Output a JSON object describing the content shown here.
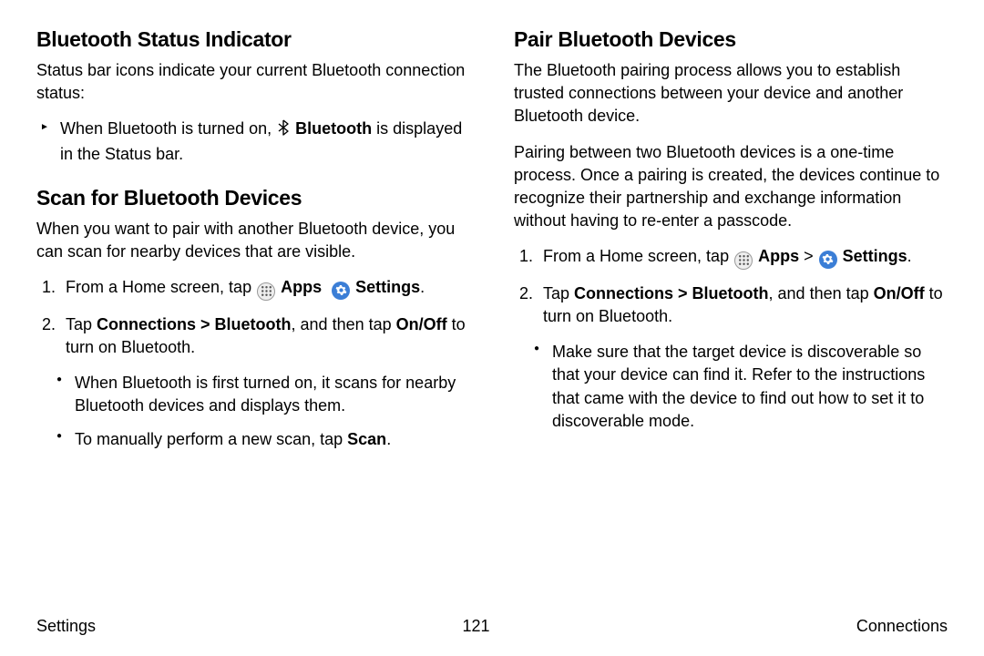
{
  "left": {
    "h1": "Bluetooth Status Indicator",
    "p1": "Status bar icons indicate your current Bluetooth connection status:",
    "b1a": "When Bluetooth is turned on, ",
    "b1_bt": "Bluetooth",
    "b1b": " is displayed in the Status bar.",
    "h2": "Scan for Bluetooth Devices",
    "p2": "When you want to pair with another Bluetooth device, you can scan for nearby devices that are visible.",
    "s1a": "From a Home screen, tap ",
    "s1_apps": "Apps",
    "s1_settings": "Settings",
    "s1_dot": ".",
    "s2a": "Tap ",
    "s2b": "Connections > Bluetooth",
    "s2c": ", and then tap ",
    "s2d": "On/Off",
    "s2e": " to turn on Bluetooth.",
    "s2_sub1": "When Bluetooth is first turned on, it scans for nearby Bluetooth devices and displays them.",
    "s2_sub2a": "To manually perform a new scan, tap ",
    "s2_sub2b": "Scan",
    "s2_sub2c": "."
  },
  "right": {
    "h1": "Pair Bluetooth Devices",
    "p1": "The Bluetooth pairing process allows you to establish trusted connections between your device and another Bluetooth device.",
    "p2": "Pairing between two Bluetooth devices is a one-time process. Once a pairing is created, the devices continue to recognize their partnership and exchange information without having to re-enter a passcode.",
    "s1a": "From a Home screen, tap ",
    "s1_apps": "Apps",
    "s1_gt": " > ",
    "s1_settings": "Settings",
    "s1_dot": ".",
    "s2a": "Tap ",
    "s2b": "Connections > Bluetooth",
    "s2c": ", and then tap ",
    "s2d": "On/Off",
    "s2e": " to turn on Bluetooth.",
    "s2_sub1": "Make sure that the target device is discoverable so that your device can find it. Refer to the instructions that came with the device to find out how to set it to discoverable mode."
  },
  "footer": {
    "left": "Settings",
    "center": "121",
    "right": "Connections"
  }
}
